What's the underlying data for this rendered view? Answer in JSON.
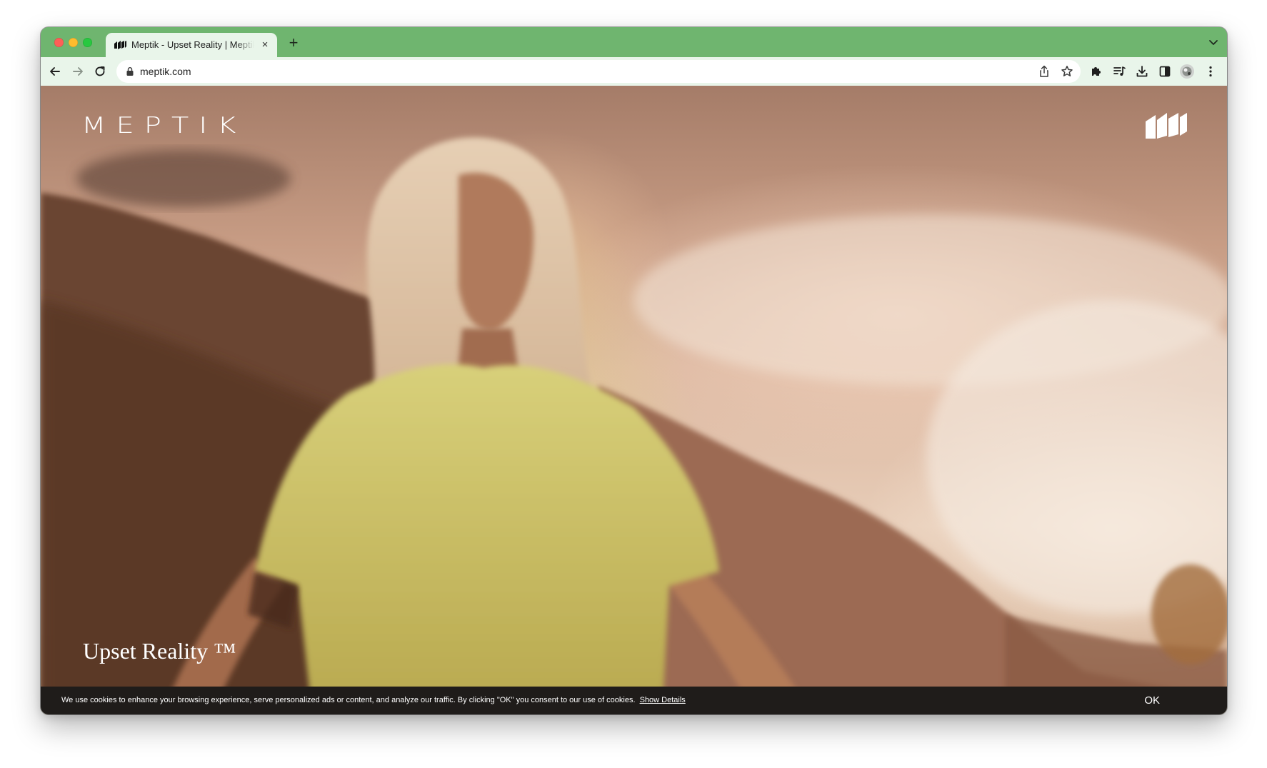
{
  "browser": {
    "tab": {
      "title": "Meptik - Upset Reality | Meptik",
      "close_glyph": "×"
    },
    "new_tab_glyph": "+",
    "url": "meptik.com",
    "theme_color": "#6fb56f",
    "toolbar_color": "#e9f5ea"
  },
  "page": {
    "brand": "MEPTIK",
    "hero_title": "Upset Reality ™",
    "cookie": {
      "text": "We use cookies to enhance your browsing experience, serve personalized ads or content, and analyze our traffic. By clicking \"OK\" you consent to our use of cookies.",
      "link": "Show Details",
      "ok": "OK"
    }
  }
}
